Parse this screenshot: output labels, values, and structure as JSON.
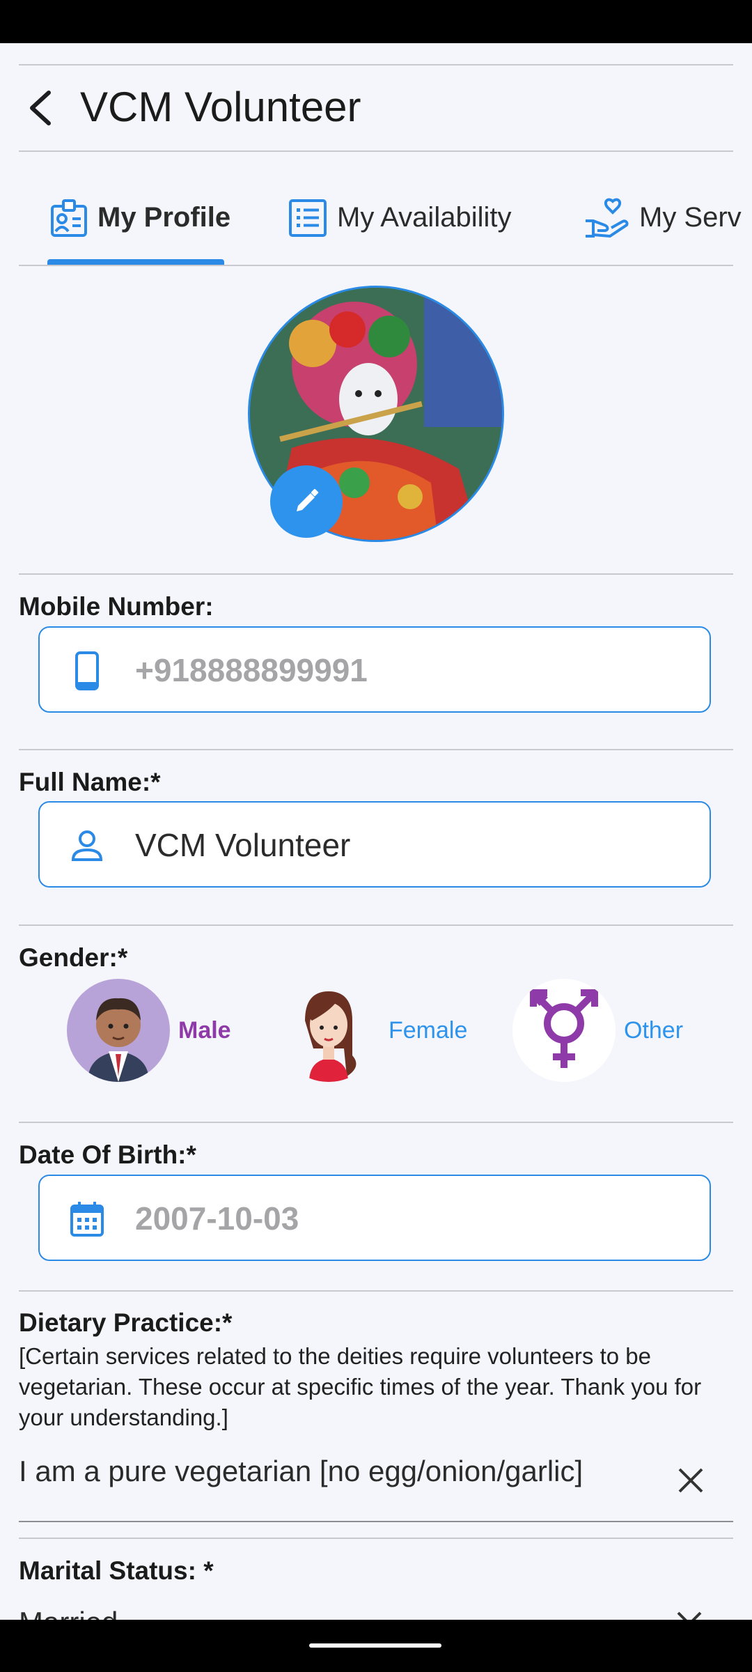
{
  "app": {
    "title": "VCM Volunteer"
  },
  "tabs": [
    {
      "label": "My Profile",
      "icon": "id-badge-icon",
      "active": true
    },
    {
      "label": "My Availability",
      "icon": "list-icon",
      "active": false
    },
    {
      "label": "My Serv",
      "icon": "hand-heart-icon",
      "active": false
    }
  ],
  "profile": {
    "mobile_label": "Mobile Number:",
    "mobile_value": "+918888899991",
    "name_label": "Full Name:*",
    "name_value": "VCM Volunteer",
    "gender_label": "Gender:*",
    "gender_options": [
      {
        "label": "Male",
        "selected": true
      },
      {
        "label": "Female",
        "selected": false
      },
      {
        "label": "Other",
        "selected": false
      }
    ],
    "dob_label": "Date Of Birth:*",
    "dob_value": "2007-10-03",
    "diet_label": "Dietary Practice:*",
    "diet_note": "[Certain services related to the deities require volunteers to be vegetarian. These occur at specific times of the year. Thank you for your understanding.]",
    "diet_value": "I am a pure vegetarian [no egg/onion/garlic]",
    "marital_label": "Marital Status: *",
    "marital_value": "Married"
  },
  "colors": {
    "accent": "#2a8ae6",
    "selected_gender": "#8e3aa8",
    "unselected_gender": "#2e93ec"
  }
}
